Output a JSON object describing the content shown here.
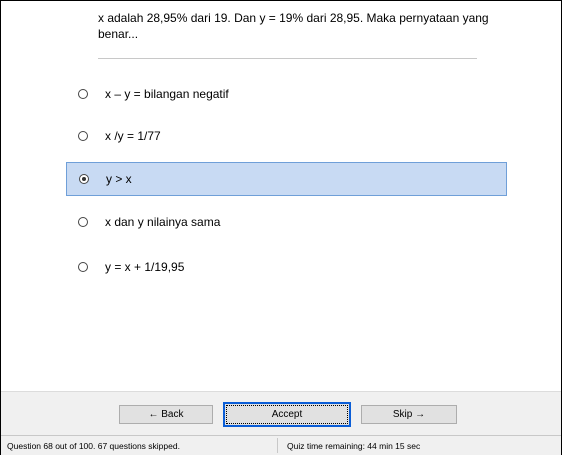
{
  "question": {
    "text": "x adalah 28,95% dari 19.  Dan y = 19% dari 28,95. Maka pernyataan yang benar..."
  },
  "options": [
    {
      "label": "x – y = bilangan negatif",
      "selected": false
    },
    {
      "label": "x /y = 1/77",
      "selected": false
    },
    {
      "label": "y > x",
      "selected": true
    },
    {
      "label": "x dan y nilainya sama",
      "selected": false
    },
    {
      "label": "y = x + 1/19,95",
      "selected": false
    }
  ],
  "buttons": {
    "back": "← Back",
    "accept": "Accept",
    "skip": "Skip →"
  },
  "status": {
    "progress": "Question 68 out of 100. 67 questions skipped.",
    "time": "Quiz time remaining: 44 min 15 sec"
  }
}
